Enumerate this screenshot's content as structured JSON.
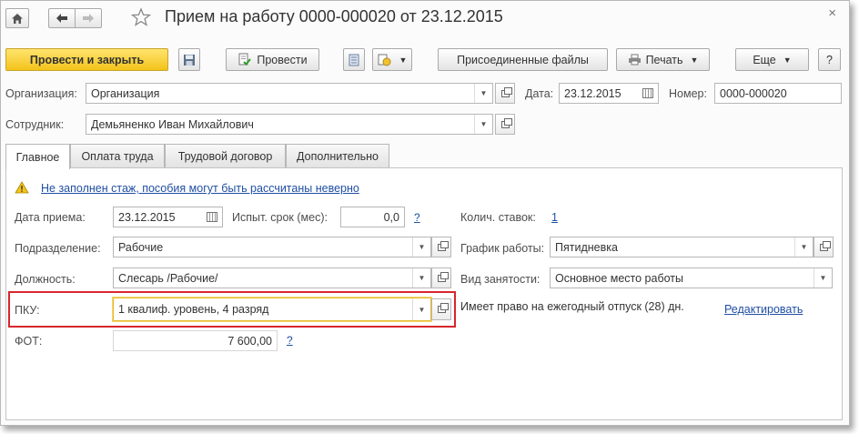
{
  "window": {
    "title": "Прием на работу 0000-000020 от 23.12.2015",
    "close_glyph": "×"
  },
  "toolbar": {
    "post_and_close": "Провести и закрыть",
    "post": "Провести",
    "attached_files": "Присоединенные файлы",
    "print": "Печать",
    "more": "Еще",
    "help": "?"
  },
  "header": {
    "organization": {
      "label": "Организация:",
      "value": "Организация"
    },
    "date": {
      "label": "Дата:",
      "value": "23.12.2015"
    },
    "number": {
      "label": "Номер:",
      "value": "0000-000020"
    },
    "employee": {
      "label": "Сотрудник:",
      "value": "Демьяненко Иван Михайлович"
    }
  },
  "tabs": [
    {
      "label": "Главное",
      "active": true
    },
    {
      "label": "Оплата труда",
      "active": false
    },
    {
      "label": "Трудовой договор",
      "active": false
    },
    {
      "label": "Дополнительно",
      "active": false
    }
  ],
  "main": {
    "warning": "Не заполнен стаж, пособия могут быть рассчитаны неверно",
    "hire_date": {
      "label": "Дата приема:",
      "value": "23.12.2015"
    },
    "probation": {
      "label": "Испыт. срок (мес):",
      "value": "0,0",
      "help": "?"
    },
    "rates": {
      "label": "Колич. ставок:",
      "value": "1"
    },
    "department": {
      "label": "Подразделение:",
      "value": "Рабочие"
    },
    "schedule": {
      "label": "График работы:",
      "value": "Пятидневка"
    },
    "position": {
      "label": "Должность:",
      "value": "Слесарь /Рабочие/"
    },
    "employment_type": {
      "label": "Вид занятости:",
      "value": "Основное место работы"
    },
    "pku": {
      "label": "ПКУ:",
      "value": "1 квалиф. уровень, 4 разряд"
    },
    "vacation_note": "Имеет право на ежегодный отпуск (28) дн.",
    "edit_link": "Редактировать",
    "fot": {
      "label": "ФОТ:",
      "value": "7 600,00",
      "help": "?"
    }
  },
  "colors": {
    "primary_button": "#f3c31a",
    "highlight_frame": "#d8262c",
    "focus_border": "#e8b927",
    "link": "#1f4fa3"
  }
}
